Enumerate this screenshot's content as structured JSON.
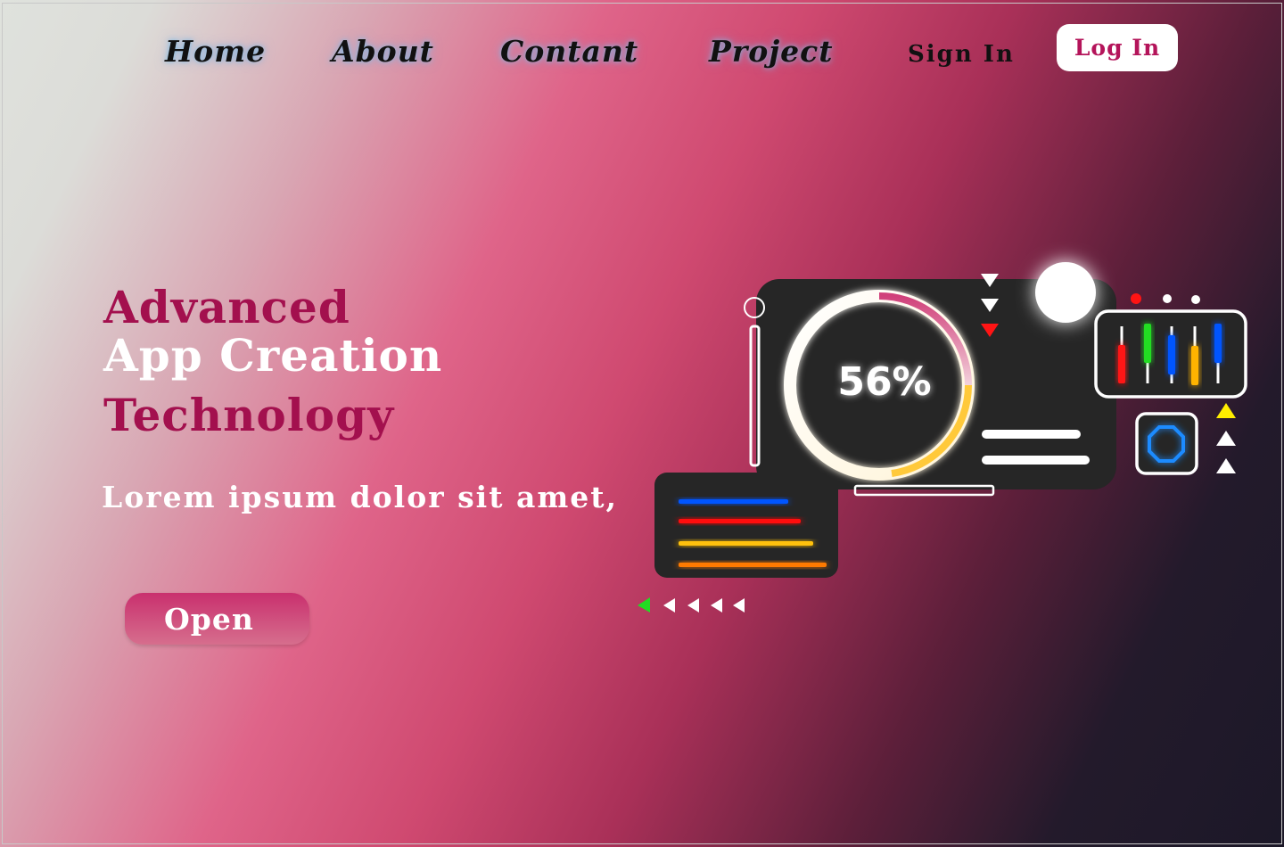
{
  "nav": {
    "home": "Home",
    "about": "About",
    "contant": "Contant",
    "project": "Project",
    "sign_in": "Sign In",
    "log_in": "Log In"
  },
  "hero": {
    "line1": "Advanced",
    "line2": "App Creation",
    "line3": "Technology",
    "subtitle": "Lorem ipsum dolor sit amet,",
    "button": "Open"
  },
  "dashboard": {
    "progress_label": "56%",
    "progress_value": 0.56,
    "colors": {
      "accent": "#b4145a",
      "panel": "#262626",
      "bars": [
        "#0055ff",
        "#ff1010",
        "#ffc107",
        "#ff7a00"
      ],
      "sliders": [
        "#ff1010",
        "#22dd22",
        "#0055ff",
        "#ffb300",
        "#0055ff"
      ]
    },
    "icons": [
      "down-triangle-icon",
      "up-triangle-icon",
      "left-triangle-icon",
      "octagon-icon",
      "circle-icon"
    ]
  }
}
